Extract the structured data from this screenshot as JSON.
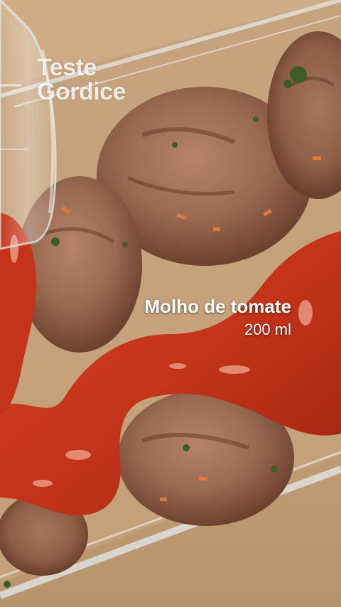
{
  "watermark": {
    "line1": "Teste",
    "line2": "Gordice"
  },
  "caption": {
    "title": "Molho de tomate",
    "quantity": "200 ml"
  },
  "colors": {
    "board": "#c9a680",
    "glass_edge": "#dfe6e6",
    "meat": "#9a6a52",
    "meat_dark": "#6e4130",
    "sauce": "#c4341a",
    "sauce_dark": "#9c2410",
    "herb": "#3f5b2a"
  }
}
